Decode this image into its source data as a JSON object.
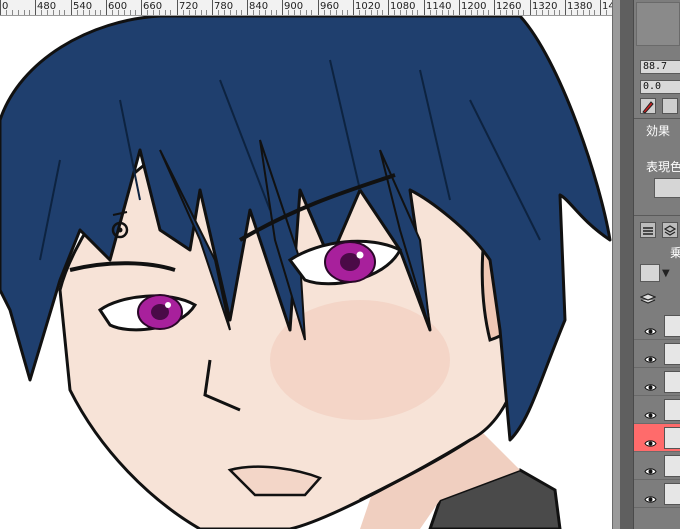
{
  "ruler": {
    "labels": [
      "0",
      "480",
      "540",
      "600",
      "660",
      "720",
      "780",
      "840",
      "900",
      "960",
      "1020",
      "1080",
      "1140",
      "1200",
      "1260",
      "1320",
      "1380",
      "14"
    ]
  },
  "panel": {
    "opacity_value": "88.7",
    "offset_value": "0.0",
    "effect_label": "効果",
    "expression_color_label": "表現色",
    "tab_label": "乗"
  },
  "layers": [
    {
      "visible": true,
      "active": false
    },
    {
      "visible": true,
      "active": false
    },
    {
      "visible": true,
      "active": false
    },
    {
      "visible": true,
      "active": false
    },
    {
      "visible": true,
      "active": true
    },
    {
      "visible": true,
      "active": false
    },
    {
      "visible": true,
      "active": false
    }
  ],
  "colors": {
    "hair": "#1f3f6e",
    "skin": "#f5ddd0",
    "iris": "#a8209c",
    "active_layer": "#ff6b6b",
    "collar": "#4a4a4a"
  }
}
